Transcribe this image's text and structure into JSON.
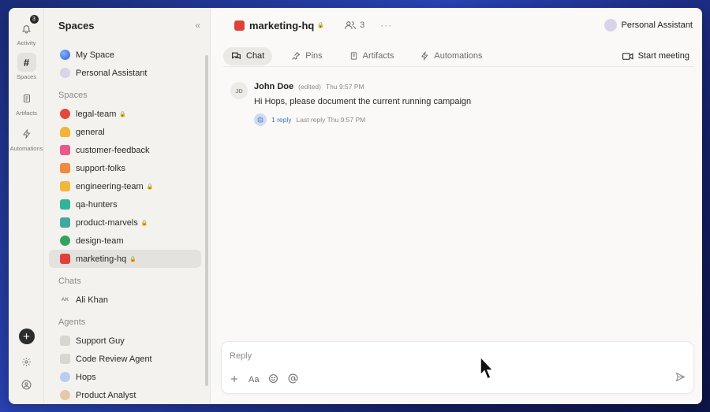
{
  "rail": {
    "activity_label": "Activity",
    "activity_badge": "3",
    "spaces_label": "Spaces",
    "artifacts_label": "Artifacts",
    "automations_label": "Automations",
    "spaces_glyph": "#"
  },
  "sidebar": {
    "title": "Spaces",
    "top_items": [
      {
        "label": "My Space",
        "icon": "globe-icon"
      },
      {
        "label": "Personal Assistant",
        "icon": "assistant-avatar"
      }
    ],
    "spaces_section": "Spaces",
    "spaces": [
      {
        "label": "legal-team",
        "locked": true,
        "color": "#e2483d"
      },
      {
        "label": "general",
        "locked": false,
        "color": "#f1b43b"
      },
      {
        "label": "customer-feedback",
        "locked": false,
        "color": "#e9588a"
      },
      {
        "label": "support-folks",
        "locked": false,
        "color": "#f08a3c"
      },
      {
        "label": "engineering-team",
        "locked": true,
        "color": "#f3b63c"
      },
      {
        "label": "qa-hunters",
        "locked": false,
        "color": "#2fb39b"
      },
      {
        "label": "product-marvels",
        "locked": true,
        "color": "#3fa9a0"
      },
      {
        "label": "design-team",
        "locked": false,
        "color": "#33a35a"
      },
      {
        "label": "marketing-hq",
        "locked": true,
        "color": "#e0413a",
        "active": true
      }
    ],
    "chats_section": "Chats",
    "chats": [
      {
        "initials": "AK",
        "label": "Ali Khan"
      }
    ],
    "agents_section": "Agents",
    "agents": [
      {
        "label": "Support Guy"
      },
      {
        "label": "Code Review Agent"
      },
      {
        "label": "Hops"
      },
      {
        "label": "Product Analyst"
      }
    ],
    "lock_glyph": "🔒"
  },
  "header": {
    "channel": "marketing-hq",
    "member_count": "3",
    "more": "···",
    "assistant": "Personal Assistant"
  },
  "tabs": [
    {
      "label": "Chat",
      "active": true
    },
    {
      "label": "Pins"
    },
    {
      "label": "Artifacts"
    },
    {
      "label": "Automations"
    }
  ],
  "start_meeting": "Start meeting",
  "message": {
    "avatar": "JD",
    "author": "John Doe",
    "edited": "(edited)",
    "time": "Thu 9:57 PM",
    "text": "Hi Hops, please document the current running campaign",
    "reply_count": "1 reply",
    "last_reply": "Last reply Thu 9:57 PM"
  },
  "composer": {
    "placeholder": "Reply",
    "format_label": "Aa"
  }
}
